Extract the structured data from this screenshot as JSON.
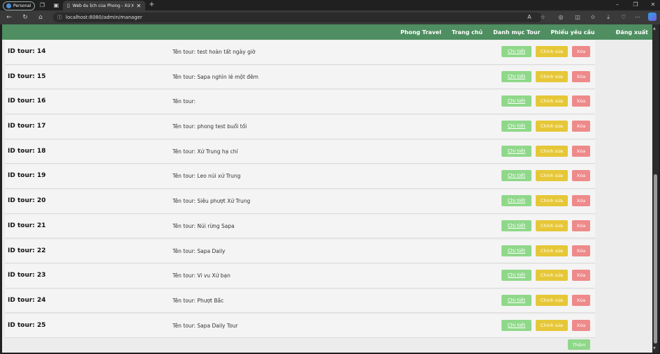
{
  "browser": {
    "profile_label": "Personal",
    "tab_title": "Web du lịch của Phong - Xứ X p",
    "url": "localhost:8080/admin/manager",
    "icons": [
      "workspaces-icon",
      "tab-actions-icon",
      "back-icon",
      "refresh-icon",
      "home-icon",
      "info-icon",
      "read-aloud-icon",
      "favorite-icon",
      "extensions-icon",
      "split-screen-icon",
      "favorites-icon",
      "downloads-icon",
      "browser-essentials-icon",
      "more-icon",
      "copilot-icon"
    ]
  },
  "nav": {
    "brand": "Phong Travel",
    "home": "Trang chủ",
    "tour_catalog": "Danh mục Tour",
    "requests": "Phiếu yêu cầu",
    "logout": "Đăng xuất"
  },
  "buttons": {
    "detail": "Chi tiết",
    "edit": "Chỉnh sửa",
    "delete": "Xóa",
    "add": "Thêm"
  },
  "tours": [
    {
      "id_label": "ID tour: 14",
      "name_label": "Tên tour: test hoàn tất ngày giờ"
    },
    {
      "id_label": "ID tour: 15",
      "name_label": "Tên tour: Sapa nghìn lẻ một đêm"
    },
    {
      "id_label": "ID tour: 16",
      "name_label": "Tên tour:"
    },
    {
      "id_label": "ID tour: 17",
      "name_label": "Tên tour: phong test buổi tối"
    },
    {
      "id_label": "ID tour: 18",
      "name_label": "Tên tour: Xứ Trung hạ chí"
    },
    {
      "id_label": "ID tour: 19",
      "name_label": "Tên tour: Leo núi xứ Trung"
    },
    {
      "id_label": "ID tour: 20",
      "name_label": "Tên tour: Siêu phượt Xứ Trung"
    },
    {
      "id_label": "ID tour: 21",
      "name_label": "Tên tour: Núi rừng Sapa"
    },
    {
      "id_label": "ID tour: 22",
      "name_label": "Tên tour: Sapa Daily"
    },
    {
      "id_label": "ID tour: 23",
      "name_label": "Tên tour: Vi vu Xứ bạn"
    },
    {
      "id_label": "ID tour: 24",
      "name_label": "Tên tour: Phượt Bắc"
    },
    {
      "id_label": "ID tour: 25",
      "name_label": "Tên tour: Sapa Daily Tour"
    }
  ],
  "colors": {
    "navbar": "#4e8e60",
    "detail_button": "#8fd88a",
    "edit_button": "#e6c737",
    "delete_button": "#ee8a8a"
  }
}
